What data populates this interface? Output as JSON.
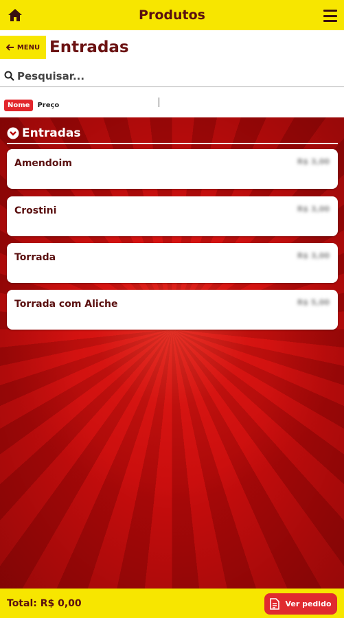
{
  "topbar": {
    "title": "Produtos"
  },
  "header": {
    "menu_label": "MENU",
    "title": "Entradas"
  },
  "search": {
    "placeholder": "Pesquisar..."
  },
  "sort": {
    "active": "Nome",
    "other": "Preço"
  },
  "section": {
    "title": "Entradas"
  },
  "products": [
    {
      "name": "Amendoim",
      "price": "R$ 3,00"
    },
    {
      "name": "Crostini",
      "price": "R$ 3,00"
    },
    {
      "name": "Torrada",
      "price": "R$ 3,00"
    },
    {
      "name": "Torrada com Aliche",
      "price": "R$ 5,00"
    }
  ],
  "footer": {
    "total": "Total: R$ 0,00",
    "order_button": "Ver pedido"
  },
  "colors": {
    "yellow": "#f7e600",
    "red": "#e2262c",
    "dark_red": "#6b1212"
  }
}
